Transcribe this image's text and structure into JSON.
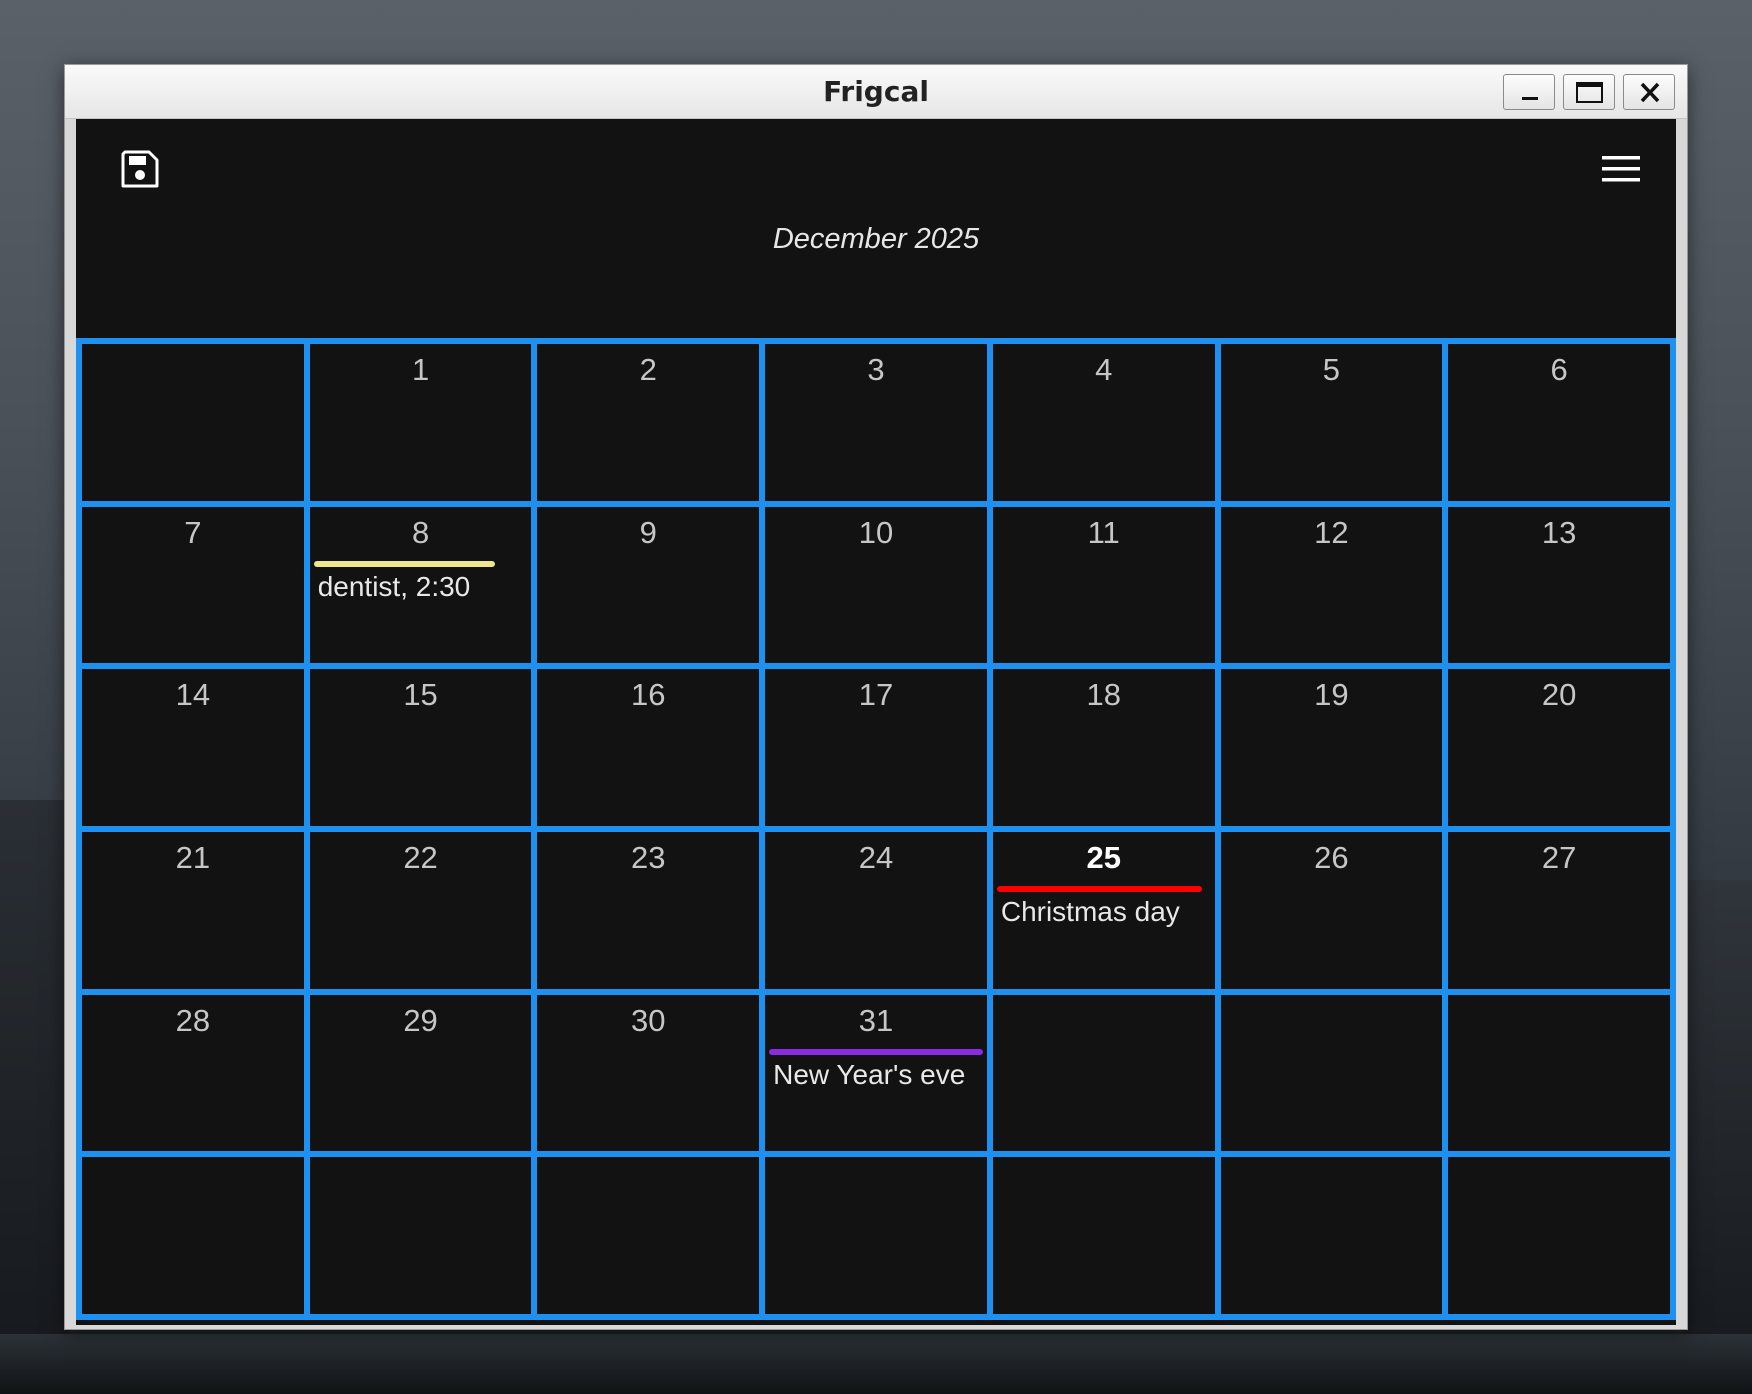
{
  "window": {
    "title": "Frigcal"
  },
  "header": {
    "month_label": "December 2025"
  },
  "calendar": {
    "today": "25",
    "days": [
      "",
      "1",
      "2",
      "3",
      "4",
      "5",
      "6",
      "7",
      "8",
      "9",
      "10",
      "11",
      "12",
      "13",
      "14",
      "15",
      "16",
      "17",
      "18",
      "19",
      "20",
      "21",
      "22",
      "23",
      "24",
      "25",
      "26",
      "27",
      "28",
      "29",
      "30",
      "31",
      "",
      "",
      "",
      "",
      "",
      "",
      "",
      "",
      "",
      ""
    ],
    "events": [
      {
        "day": "8",
        "label": "dentist, 2:30",
        "color": "#f0e68c",
        "bar_fraction": 0.85
      },
      {
        "day": "25",
        "label": "Christmas day",
        "color": "#ff0000",
        "bar_fraction": 0.96
      },
      {
        "day": "31",
        "label": "New Year's eve",
        "color": "#8a2be2",
        "bar_fraction": 1.0
      }
    ]
  },
  "colors": {
    "grid": "#1e90f0",
    "cell_bg": "#121212"
  },
  "icons": {
    "save": "save-icon",
    "menu": "hamburger-menu-icon",
    "minimize": "minimize-icon",
    "maximize": "maximize-icon",
    "close": "close-icon"
  }
}
